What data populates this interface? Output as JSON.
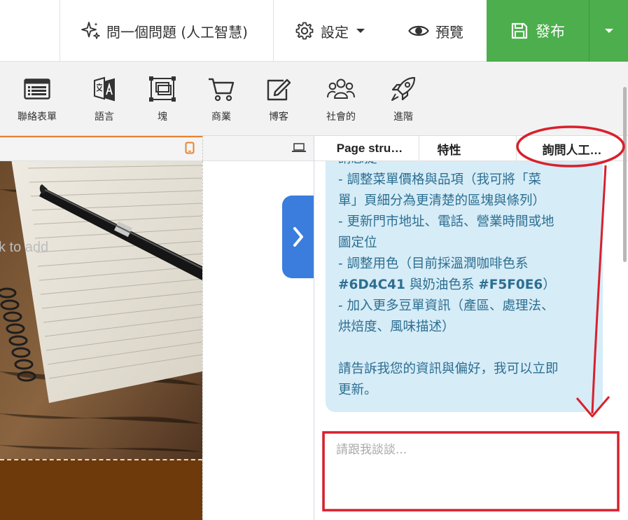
{
  "topbar": {
    "ask_ai_label": "問一個問題 (人工智慧)",
    "settings_label": "設定",
    "preview_label": "預覽",
    "publish_label": "發布"
  },
  "toolbar": {
    "items": [
      {
        "label": "聯絡表單",
        "icon": "form-icon"
      },
      {
        "label": "語言",
        "icon": "translate-icon"
      },
      {
        "label": "塊",
        "icon": "block-icon"
      },
      {
        "label": "商業",
        "icon": "cart-icon"
      },
      {
        "label": "博客",
        "icon": "edit-icon"
      },
      {
        "label": "社會的",
        "icon": "people-icon"
      },
      {
        "label": "進階",
        "icon": "rocket-icon"
      }
    ]
  },
  "canvas": {
    "placeholder_text": "k to add"
  },
  "panel": {
    "tabs": [
      {
        "label": "Page stru…"
      },
      {
        "label": "特性"
      },
      {
        "label": "詢問人工…"
      }
    ],
    "message_lines": [
      "請您提",
      "- 調整菜單價格與品項（我可將「菜",
      "單」頁細分為更清楚的區塊與條列）",
      "- 更新門市地址、電話、營業時間或地",
      "圖定位",
      "- 調整用色（目前採溫潤咖啡色系",
      "- 加入更多豆單資訊（產區、處理法、",
      "烘焙度、風味描述）",
      "",
      "請告訴我您的資訊與偏好，我可以立即",
      "更新。"
    ],
    "color_line": {
      "color_a": "#6D4C41",
      "joiner": " 與奶油色系 ",
      "color_b": "#F5F0E6",
      "tail": "）"
    },
    "chat_placeholder": "請跟我談談..."
  },
  "colors": {
    "publish_green": "#4cae4c",
    "accent_blue": "#3b7ddd",
    "message_bg": "#d6ecf7",
    "annotation_red": "#d9202c",
    "footer_brown": "#6e3a0b"
  }
}
